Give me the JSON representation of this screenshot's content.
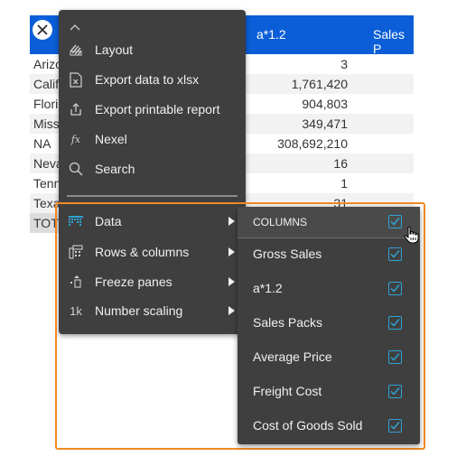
{
  "table": {
    "header": {
      "col2": "a*1.2",
      "col3": "Sales P"
    },
    "rows": [
      {
        "name": "Arizo",
        "value": "3"
      },
      {
        "name": "Calif",
        "value": "1,761,420"
      },
      {
        "name": "Flori",
        "value": "904,803"
      },
      {
        "name": "Miss",
        "value": "349,471"
      },
      {
        "name": "NA",
        "value": "308,692,210"
      },
      {
        "name": "Neva",
        "value": "16"
      },
      {
        "name": "Tenn",
        "value": "1"
      },
      {
        "name": "Texa",
        "value": "31"
      },
      {
        "name": "TOT",
        "value": ""
      }
    ]
  },
  "menu": {
    "items": [
      {
        "label": "Layout",
        "icon": "layout-icon"
      },
      {
        "label": "Export data to xlsx",
        "icon": "xlsx-file-icon"
      },
      {
        "label": "Export printable report",
        "icon": "export-share-icon"
      },
      {
        "label": "Nexel",
        "icon": "fx-icon"
      },
      {
        "label": "Search",
        "icon": "search-icon"
      }
    ],
    "submenus": [
      {
        "label": "Data",
        "icon": "data-grid-icon"
      },
      {
        "label": "Rows & columns",
        "icon": "rows-columns-icon"
      },
      {
        "label": "Freeze panes",
        "icon": "freeze-panes-icon"
      },
      {
        "label": "Number scaling",
        "icon": "number-scaling-icon",
        "icon_text": "1k"
      }
    ]
  },
  "columns_panel": {
    "header": "COLUMNS",
    "header_checked": true,
    "items": [
      {
        "label": "Gross Sales",
        "checked": true
      },
      {
        "label": "a*1.2",
        "checked": true
      },
      {
        "label": "Sales Packs",
        "checked": true
      },
      {
        "label": "Average Price",
        "checked": true
      },
      {
        "label": "Freight Cost",
        "checked": true
      },
      {
        "label": "Cost of Goods Sold",
        "checked": true
      }
    ]
  },
  "colors": {
    "header_blue": "#0b5ed7",
    "menu_bg": "#3f3f3f",
    "highlight_orange": "#f08a24",
    "checkbox_blue": "#2fa3d4"
  }
}
